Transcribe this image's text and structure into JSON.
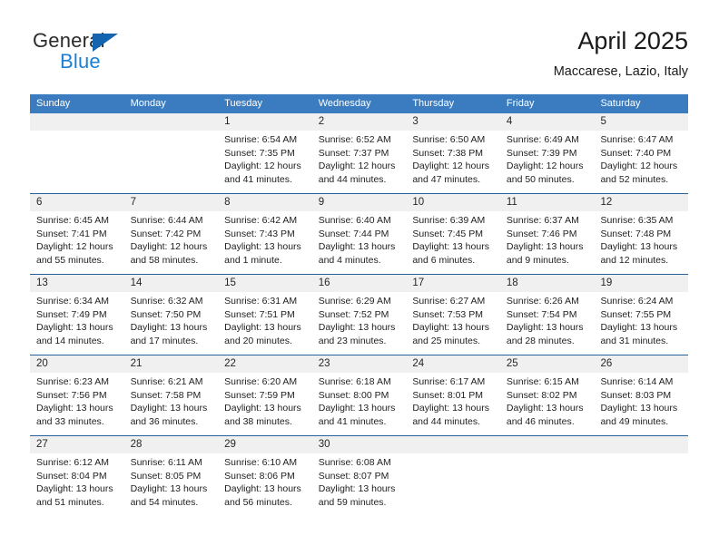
{
  "logo": {
    "word1": "General",
    "word2": "Blue",
    "triangle_color": "#1464af",
    "blue_color": "#1b7fd4"
  },
  "header": {
    "title": "April 2025",
    "subtitle": "Maccarese, Lazio, Italy"
  },
  "theme": {
    "header_blue": "#3b7cc0",
    "separator_blue": "#2a6099",
    "daynum_bg": "#f0f0f0"
  },
  "calendar": {
    "day_names": [
      "Sunday",
      "Monday",
      "Tuesday",
      "Wednesday",
      "Thursday",
      "Friday",
      "Saturday"
    ],
    "weeks": [
      [
        {
          "day": "",
          "lines": []
        },
        {
          "day": "",
          "lines": []
        },
        {
          "day": "1",
          "lines": [
            "Sunrise: 6:54 AM",
            "Sunset: 7:35 PM",
            "Daylight: 12 hours",
            "and 41 minutes."
          ]
        },
        {
          "day": "2",
          "lines": [
            "Sunrise: 6:52 AM",
            "Sunset: 7:37 PM",
            "Daylight: 12 hours",
            "and 44 minutes."
          ]
        },
        {
          "day": "3",
          "lines": [
            "Sunrise: 6:50 AM",
            "Sunset: 7:38 PM",
            "Daylight: 12 hours",
            "and 47 minutes."
          ]
        },
        {
          "day": "4",
          "lines": [
            "Sunrise: 6:49 AM",
            "Sunset: 7:39 PM",
            "Daylight: 12 hours",
            "and 50 minutes."
          ]
        },
        {
          "day": "5",
          "lines": [
            "Sunrise: 6:47 AM",
            "Sunset: 7:40 PM",
            "Daylight: 12 hours",
            "and 52 minutes."
          ]
        }
      ],
      [
        {
          "day": "6",
          "lines": [
            "Sunrise: 6:45 AM",
            "Sunset: 7:41 PM",
            "Daylight: 12 hours",
            "and 55 minutes."
          ]
        },
        {
          "day": "7",
          "lines": [
            "Sunrise: 6:44 AM",
            "Sunset: 7:42 PM",
            "Daylight: 12 hours",
            "and 58 minutes."
          ]
        },
        {
          "day": "8",
          "lines": [
            "Sunrise: 6:42 AM",
            "Sunset: 7:43 PM",
            "Daylight: 13 hours",
            "and 1 minute."
          ]
        },
        {
          "day": "9",
          "lines": [
            "Sunrise: 6:40 AM",
            "Sunset: 7:44 PM",
            "Daylight: 13 hours",
            "and 4 minutes."
          ]
        },
        {
          "day": "10",
          "lines": [
            "Sunrise: 6:39 AM",
            "Sunset: 7:45 PM",
            "Daylight: 13 hours",
            "and 6 minutes."
          ]
        },
        {
          "day": "11",
          "lines": [
            "Sunrise: 6:37 AM",
            "Sunset: 7:46 PM",
            "Daylight: 13 hours",
            "and 9 minutes."
          ]
        },
        {
          "day": "12",
          "lines": [
            "Sunrise: 6:35 AM",
            "Sunset: 7:48 PM",
            "Daylight: 13 hours",
            "and 12 minutes."
          ]
        }
      ],
      [
        {
          "day": "13",
          "lines": [
            "Sunrise: 6:34 AM",
            "Sunset: 7:49 PM",
            "Daylight: 13 hours",
            "and 14 minutes."
          ]
        },
        {
          "day": "14",
          "lines": [
            "Sunrise: 6:32 AM",
            "Sunset: 7:50 PM",
            "Daylight: 13 hours",
            "and 17 minutes."
          ]
        },
        {
          "day": "15",
          "lines": [
            "Sunrise: 6:31 AM",
            "Sunset: 7:51 PM",
            "Daylight: 13 hours",
            "and 20 minutes."
          ]
        },
        {
          "day": "16",
          "lines": [
            "Sunrise: 6:29 AM",
            "Sunset: 7:52 PM",
            "Daylight: 13 hours",
            "and 23 minutes."
          ]
        },
        {
          "day": "17",
          "lines": [
            "Sunrise: 6:27 AM",
            "Sunset: 7:53 PM",
            "Daylight: 13 hours",
            "and 25 minutes."
          ]
        },
        {
          "day": "18",
          "lines": [
            "Sunrise: 6:26 AM",
            "Sunset: 7:54 PM",
            "Daylight: 13 hours",
            "and 28 minutes."
          ]
        },
        {
          "day": "19",
          "lines": [
            "Sunrise: 6:24 AM",
            "Sunset: 7:55 PM",
            "Daylight: 13 hours",
            "and 31 minutes."
          ]
        }
      ],
      [
        {
          "day": "20",
          "lines": [
            "Sunrise: 6:23 AM",
            "Sunset: 7:56 PM",
            "Daylight: 13 hours",
            "and 33 minutes."
          ]
        },
        {
          "day": "21",
          "lines": [
            "Sunrise: 6:21 AM",
            "Sunset: 7:58 PM",
            "Daylight: 13 hours",
            "and 36 minutes."
          ]
        },
        {
          "day": "22",
          "lines": [
            "Sunrise: 6:20 AM",
            "Sunset: 7:59 PM",
            "Daylight: 13 hours",
            "and 38 minutes."
          ]
        },
        {
          "day": "23",
          "lines": [
            "Sunrise: 6:18 AM",
            "Sunset: 8:00 PM",
            "Daylight: 13 hours",
            "and 41 minutes."
          ]
        },
        {
          "day": "24",
          "lines": [
            "Sunrise: 6:17 AM",
            "Sunset: 8:01 PM",
            "Daylight: 13 hours",
            "and 44 minutes."
          ]
        },
        {
          "day": "25",
          "lines": [
            "Sunrise: 6:15 AM",
            "Sunset: 8:02 PM",
            "Daylight: 13 hours",
            "and 46 minutes."
          ]
        },
        {
          "day": "26",
          "lines": [
            "Sunrise: 6:14 AM",
            "Sunset: 8:03 PM",
            "Daylight: 13 hours",
            "and 49 minutes."
          ]
        }
      ],
      [
        {
          "day": "27",
          "lines": [
            "Sunrise: 6:12 AM",
            "Sunset: 8:04 PM",
            "Daylight: 13 hours",
            "and 51 minutes."
          ]
        },
        {
          "day": "28",
          "lines": [
            "Sunrise: 6:11 AM",
            "Sunset: 8:05 PM",
            "Daylight: 13 hours",
            "and 54 minutes."
          ]
        },
        {
          "day": "29",
          "lines": [
            "Sunrise: 6:10 AM",
            "Sunset: 8:06 PM",
            "Daylight: 13 hours",
            "and 56 minutes."
          ]
        },
        {
          "day": "30",
          "lines": [
            "Sunrise: 6:08 AM",
            "Sunset: 8:07 PM",
            "Daylight: 13 hours",
            "and 59 minutes."
          ]
        },
        {
          "day": "",
          "lines": []
        },
        {
          "day": "",
          "lines": []
        },
        {
          "day": "",
          "lines": []
        }
      ]
    ]
  }
}
